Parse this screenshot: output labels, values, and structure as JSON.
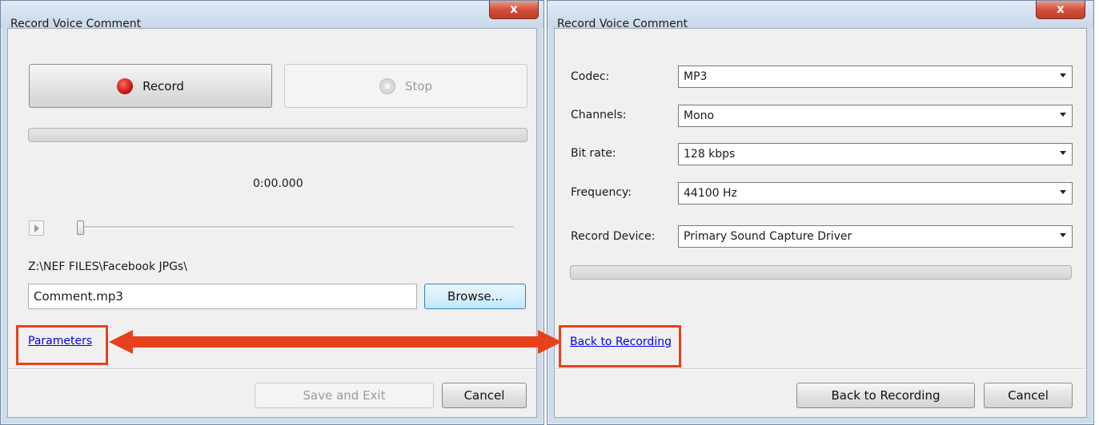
{
  "left_window": {
    "title": "Record Voice Comment",
    "close_label": "x",
    "record_label": "Record",
    "stop_label": "Stop",
    "recording_progress": 0,
    "time": "0:00.000",
    "playback_position": 0,
    "folder_path": "Z:\\NEF FILES\\Facebook JPGs\\",
    "filename": "Comment.mp3",
    "browse_label": "Browse...",
    "parameters_link": "Parameters",
    "save_exit_label": "Save and Exit",
    "cancel_label": "Cancel"
  },
  "right_window": {
    "title": "Record Voice Comment",
    "close_label": "x",
    "fields": [
      {
        "label": "Codec:",
        "value": "MP3"
      },
      {
        "label": "Channels:",
        "value": "Mono"
      },
      {
        "label": "Bit rate:",
        "value": "128 kbps"
      },
      {
        "label": "Frequency:",
        "value": "44100 Hz"
      },
      {
        "label": "Record Device:",
        "value": "Primary Sound Capture Driver"
      }
    ],
    "level_progress": 0,
    "back_link": "Back to Recording",
    "back_button_label": "Back to Recording",
    "cancel_label": "Cancel"
  },
  "colors": {
    "highlight": "#e8401c",
    "arrow": "#e8401c",
    "link": "#0000ee",
    "record_dot": "#c8161b"
  }
}
